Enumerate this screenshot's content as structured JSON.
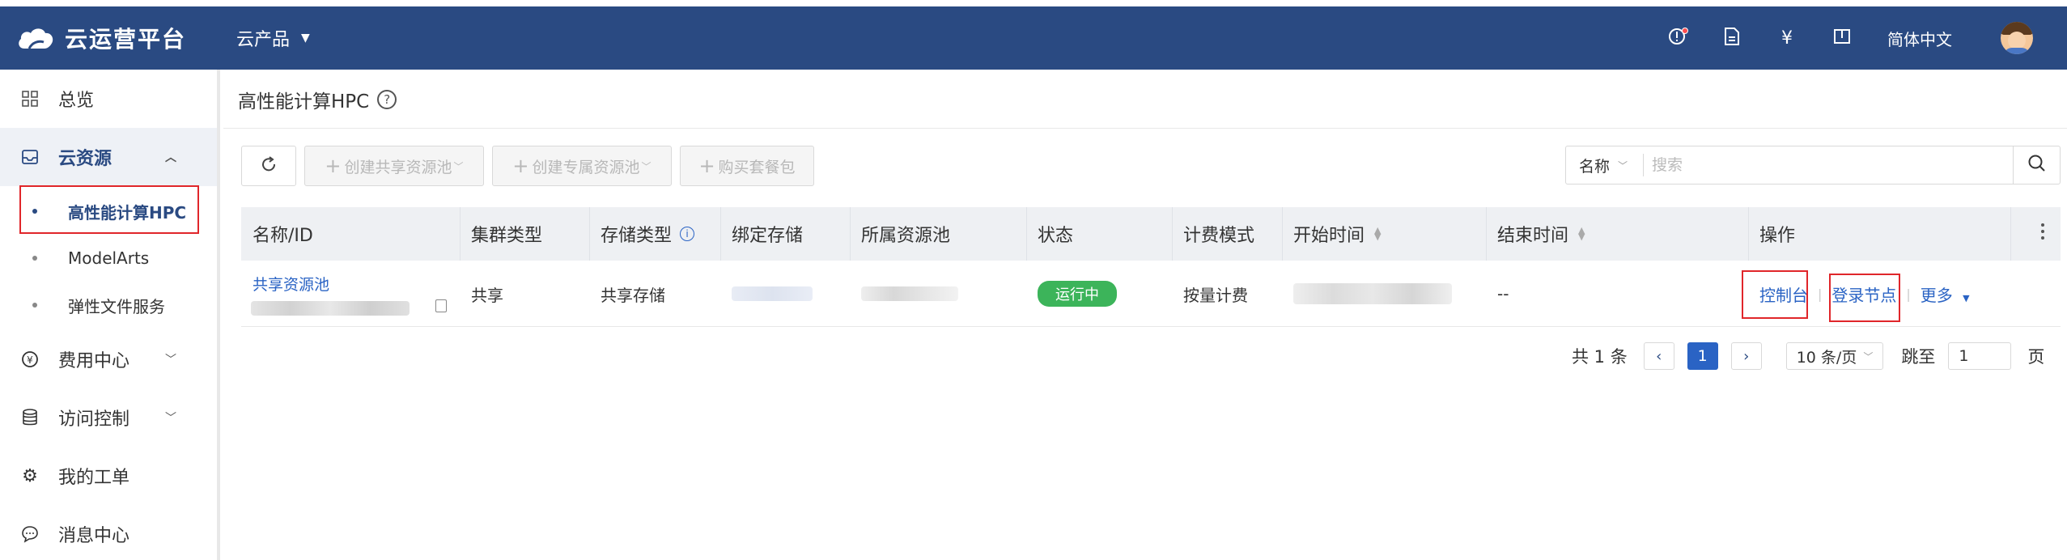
{
  "header": {
    "brand_name": "云运营平台",
    "product_menu_label": "云产品",
    "language": "简体中文",
    "brand_color": "#2a4a82"
  },
  "sidebar": {
    "items": [
      {
        "label": "总览",
        "icon": "grid-icon"
      },
      {
        "label": "云资源",
        "icon": "inbox-icon",
        "expanded": true
      },
      {
        "label": "费用中心",
        "icon": "yen-circle-icon"
      },
      {
        "label": "访问控制",
        "icon": "database-icon"
      },
      {
        "label": "我的工单",
        "icon": "gear-icon"
      },
      {
        "label": "消息中心",
        "icon": "chat-icon"
      }
    ],
    "sub_items": [
      {
        "label": "高性能计算HPC",
        "selected": true
      },
      {
        "label": "ModelArts"
      },
      {
        "label": "弹性文件服务"
      }
    ]
  },
  "page": {
    "title": "高性能计算HPC"
  },
  "toolbar": {
    "create_shared_pool": "创建共享资源池",
    "create_dedicated_pool": "创建专属资源池",
    "buy_package": "购买套餐包"
  },
  "search": {
    "field": "名称",
    "placeholder": "搜索"
  },
  "table": {
    "columns": [
      "名称/ID",
      "集群类型",
      "存储类型",
      "绑定存储",
      "所属资源池",
      "状态",
      "计费模式",
      "开始时间",
      "结束时间",
      "操作"
    ],
    "rows": [
      {
        "name": "共享资源池",
        "cluster_type": "共享",
        "storage_type": "共享存储",
        "status": "运行中",
        "billing": "按量计费",
        "end_time": "--",
        "actions": [
          "控制台",
          "登录节点",
          "更多"
        ]
      }
    ]
  },
  "pagination": {
    "total_text": "共 1 条",
    "current_page": "1",
    "page_size": "10 条/页",
    "jump_label": "跳至",
    "jump_value": "1",
    "page_suffix": "页"
  },
  "colors": {
    "status_running": "#3cb45a",
    "link": "#2a63c4",
    "highlight_box": "#e0262a"
  }
}
